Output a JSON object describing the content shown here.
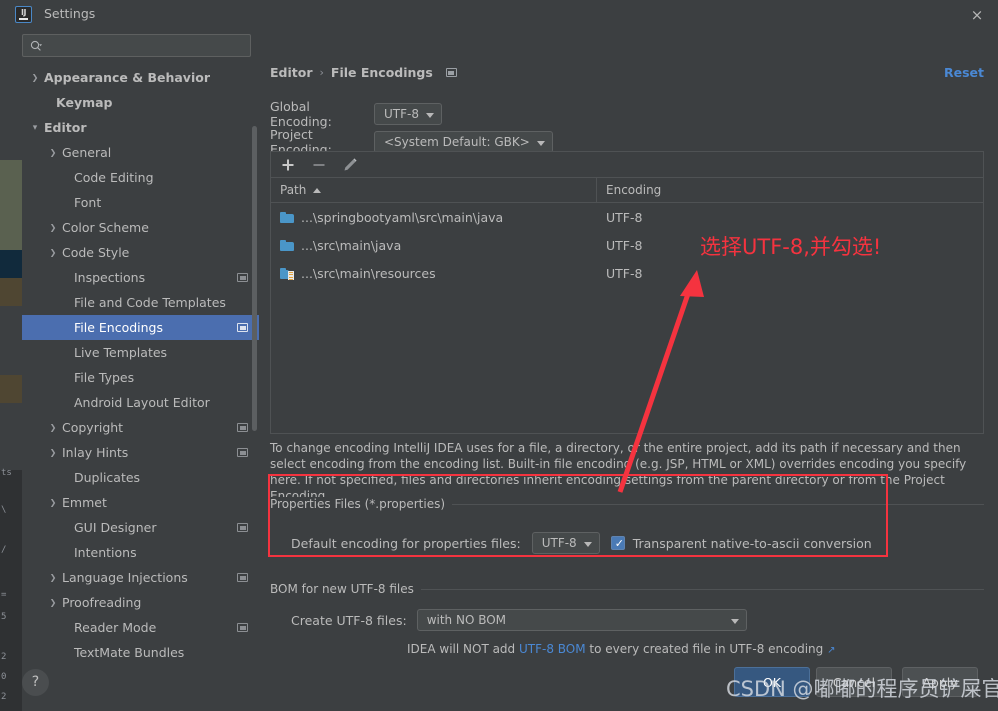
{
  "window": {
    "title": "Settings",
    "logo_text": "IJ",
    "close_icon": "×",
    "reset_label": "Reset"
  },
  "search": {
    "placeholder": "",
    "value": "",
    "icon": "search-icon"
  },
  "sidebar": {
    "items": [
      {
        "label": "Appearance & Behavior",
        "arrow": "›",
        "indent": 22,
        "bold": true,
        "chip": false,
        "selected": false
      },
      {
        "label": "Keymap",
        "arrow": "",
        "indent": 34,
        "bold": true,
        "chip": false,
        "selected": false
      },
      {
        "label": "Editor",
        "arrow": "⌄",
        "indent": 22,
        "bold": true,
        "chip": false,
        "selected": false
      },
      {
        "label": "General",
        "arrow": "›",
        "indent": 40,
        "bold": false,
        "chip": false,
        "selected": false
      },
      {
        "label": "Code Editing",
        "arrow": "",
        "indent": 52,
        "bold": false,
        "chip": false,
        "selected": false
      },
      {
        "label": "Font",
        "arrow": "",
        "indent": 52,
        "bold": false,
        "chip": false,
        "selected": false
      },
      {
        "label": "Color Scheme",
        "arrow": "›",
        "indent": 40,
        "bold": false,
        "chip": false,
        "selected": false
      },
      {
        "label": "Code Style",
        "arrow": "›",
        "indent": 40,
        "bold": false,
        "chip": false,
        "selected": false
      },
      {
        "label": "Inspections",
        "arrow": "",
        "indent": 52,
        "bold": false,
        "chip": true,
        "selected": false
      },
      {
        "label": "File and Code Templates",
        "arrow": "",
        "indent": 52,
        "bold": false,
        "chip": false,
        "selected": false
      },
      {
        "label": "File Encodings",
        "arrow": "",
        "indent": 52,
        "bold": false,
        "chip": true,
        "selected": true
      },
      {
        "label": "Live Templates",
        "arrow": "",
        "indent": 52,
        "bold": false,
        "chip": false,
        "selected": false
      },
      {
        "label": "File Types",
        "arrow": "",
        "indent": 52,
        "bold": false,
        "chip": false,
        "selected": false
      },
      {
        "label": "Android Layout Editor",
        "arrow": "",
        "indent": 52,
        "bold": false,
        "chip": false,
        "selected": false
      },
      {
        "label": "Copyright",
        "arrow": "›",
        "indent": 40,
        "bold": false,
        "chip": true,
        "selected": false
      },
      {
        "label": "Inlay Hints",
        "arrow": "›",
        "indent": 40,
        "bold": false,
        "chip": true,
        "selected": false
      },
      {
        "label": "Duplicates",
        "arrow": "",
        "indent": 52,
        "bold": false,
        "chip": false,
        "selected": false
      },
      {
        "label": "Emmet",
        "arrow": "›",
        "indent": 40,
        "bold": false,
        "chip": false,
        "selected": false
      },
      {
        "label": "GUI Designer",
        "arrow": "",
        "indent": 52,
        "bold": false,
        "chip": true,
        "selected": false
      },
      {
        "label": "Intentions",
        "arrow": "",
        "indent": 52,
        "bold": false,
        "chip": false,
        "selected": false
      },
      {
        "label": "Language Injections",
        "arrow": "›",
        "indent": 40,
        "bold": false,
        "chip": true,
        "selected": false
      },
      {
        "label": "Proofreading",
        "arrow": "›",
        "indent": 40,
        "bold": false,
        "chip": false,
        "selected": false
      },
      {
        "label": "Reader Mode",
        "arrow": "",
        "indent": 52,
        "bold": false,
        "chip": true,
        "selected": false
      },
      {
        "label": "TextMate Bundles",
        "arrow": "",
        "indent": 52,
        "bold": false,
        "chip": false,
        "selected": false
      }
    ]
  },
  "main": {
    "breadcrumb": {
      "root": "Editor",
      "separator": "›",
      "current": "File Encodings"
    },
    "global_encoding": {
      "label": "Global Encoding:",
      "value": "UTF-8"
    },
    "project_encoding": {
      "label": "Project Encoding:",
      "value": "<System Default: GBK>"
    },
    "table": {
      "toolbar": {
        "add": "add-icon",
        "remove": "remove-icon",
        "edit": "edit-icon"
      },
      "columns": [
        "Path",
        "Encoding"
      ],
      "sort_column": "Path",
      "sort_direction": "asc",
      "rows": [
        {
          "path": "...\\springbootyaml\\src\\main\\java",
          "encoding": "UTF-8",
          "icon": "folder-icon"
        },
        {
          "path": "...\\src\\main\\java",
          "encoding": "UTF-8",
          "icon": "folder-icon"
        },
        {
          "path": "...\\src\\main\\resources",
          "encoding": "UTF-8",
          "icon": "resources-folder-icon"
        }
      ]
    },
    "description": "To change encoding IntelliJ IDEA uses for a file, a directory, or the entire project, add its path if necessary and then select encoding from the encoding list. Built-in file encoding (e.g. JSP, HTML or XML) overrides encoding you specify here. If not specified, files and directories inherit encoding settings from the parent directory or from the Project Encoding.",
    "properties_group": {
      "title": "Properties Files (*.properties)",
      "default_encoding_label": "Default encoding for properties files:",
      "default_encoding_value": "UTF-8",
      "checkbox_label": "Transparent native-to-ascii conversion",
      "checkbox_checked": true,
      "checkbox_tick": "✓"
    },
    "bom_group": {
      "title": "BOM for new UTF-8 files",
      "create_label": "Create UTF-8 files:",
      "create_value": "with NO BOM",
      "note_prefix": "IDEA will NOT add ",
      "note_link": "UTF-8 BOM",
      "note_suffix": " to every created file in UTF-8 encoding ",
      "note_external_icon": "↗"
    }
  },
  "footer": {
    "help_label": "?",
    "ok_label": "OK",
    "cancel_label": "Cancel",
    "apply_label": "Apply"
  },
  "annotations": {
    "callout_text": "选择UTF-8,并勾选!",
    "callout_color": "#f5333f",
    "highlight_box_color": "#f5333f",
    "arrow_color": "#f5333f",
    "watermark": "CSDN @嘟嘟的程序员铲屎官"
  },
  "background_ide": {
    "fragments": [
      "ts",
      "\\",
      "/",
      "=",
      "5",
      "2",
      "0",
      "2"
    ]
  },
  "colors": {
    "dialog_bg": "#3c3f41",
    "selection": "#4b6eaf",
    "link": "#4a88d4",
    "accent_red": "#f5333f",
    "folder_blue": "#4a96c8",
    "ok_button": "#365880"
  }
}
